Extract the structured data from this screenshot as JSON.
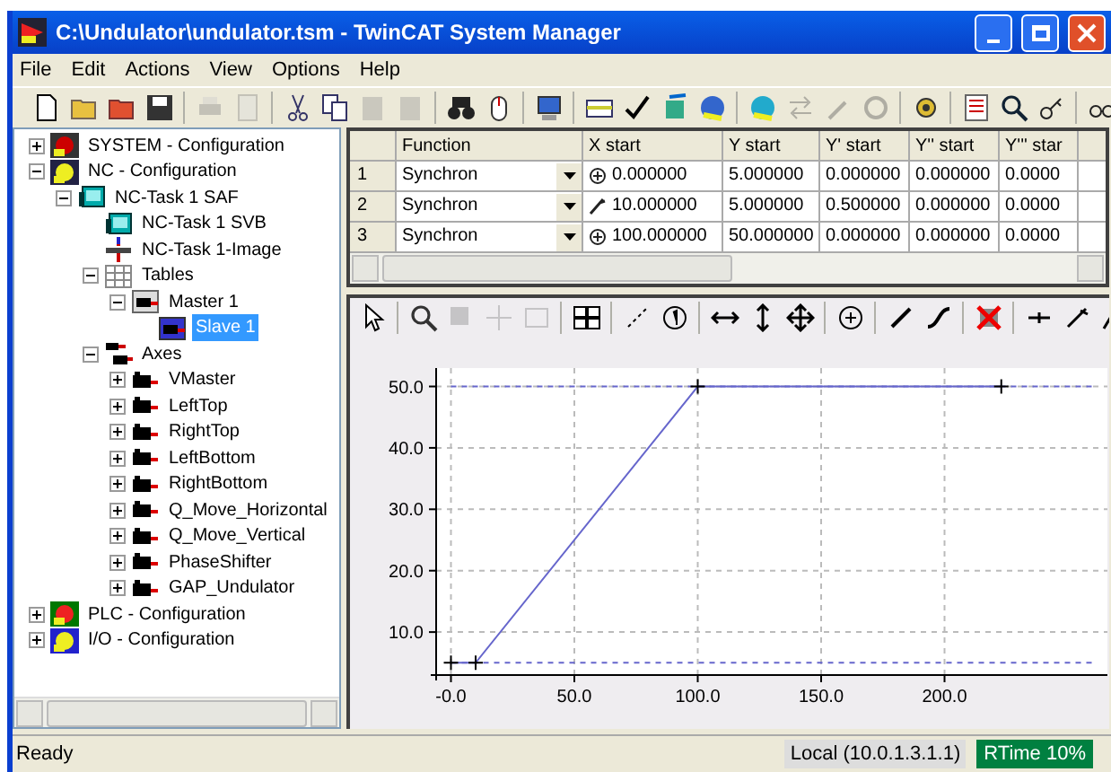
{
  "window": {
    "title": "C:\\Undulator\\undulator.tsm - TwinCAT System Manager"
  },
  "menu": [
    "File",
    "Edit",
    "Actions",
    "View",
    "Options",
    "Help"
  ],
  "tree": [
    {
      "label": "SYSTEM - Configuration",
      "kind": "system",
      "expanded": false
    },
    {
      "label": "NC - Configuration",
      "kind": "nc",
      "expanded": true,
      "children": [
        {
          "label": "NC-Task 1 SAF",
          "kind": "task",
          "expanded": true,
          "children": [
            {
              "label": "NC-Task 1 SVB",
              "kind": "task"
            },
            {
              "label": "NC-Task 1-Image",
              "kind": "image"
            },
            {
              "label": "Tables",
              "kind": "tables",
              "expanded": true,
              "children": [
                {
                  "label": "Master 1",
                  "kind": "table",
                  "expanded": true,
                  "children": [
                    {
                      "label": "Slave 1",
                      "kind": "slave",
                      "selected": true
                    }
                  ]
                }
              ]
            },
            {
              "label": "Axes",
              "kind": "axes",
              "expanded": true,
              "children": [
                {
                  "label": "VMaster",
                  "kind": "axis",
                  "expanded": false
                },
                {
                  "label": "LeftTop",
                  "kind": "axis",
                  "expanded": false
                },
                {
                  "label": "RightTop",
                  "kind": "axis",
                  "expanded": false
                },
                {
                  "label": "LeftBottom",
                  "kind": "axis",
                  "expanded": false
                },
                {
                  "label": "RightBottom",
                  "kind": "axis",
                  "expanded": false
                },
                {
                  "label": "Q_Move_Horizontal",
                  "kind": "axis",
                  "expanded": false
                },
                {
                  "label": "Q_Move_Vertical",
                  "kind": "axis",
                  "expanded": false
                },
                {
                  "label": "PhaseShifter",
                  "kind": "axis",
                  "expanded": false
                },
                {
                  "label": "GAP_Undulator",
                  "kind": "axis",
                  "expanded": false
                }
              ]
            }
          ]
        }
      ]
    },
    {
      "label": "PLC - Configuration",
      "kind": "plc",
      "expanded": false
    },
    {
      "label": "I/O - Configuration",
      "kind": "io",
      "expanded": false
    }
  ],
  "table": {
    "columns": [
      "",
      "Function",
      "X start",
      "Y start",
      "Y' start",
      "Y'' start",
      "Y''' star"
    ],
    "rows": [
      {
        "kind": "circle",
        "cells": [
          "1",
          "Synchron",
          "0.000000",
          "5.000000",
          "0.000000",
          "0.000000",
          "0.0000"
        ]
      },
      {
        "kind": "slope",
        "cells": [
          "2",
          "Synchron",
          "10.000000",
          "5.000000",
          "0.500000",
          "0.000000",
          "0.0000"
        ]
      },
      {
        "kind": "circle",
        "cells": [
          "3",
          "Synchron",
          "100.000000",
          "50.000000",
          "0.000000",
          "0.000000",
          "0.0000"
        ]
      }
    ]
  },
  "chart": {
    "chart_data": {
      "type": "line",
      "x": [
        0,
        10,
        100,
        223
      ],
      "grid": true,
      "ref_lines": [
        {
          "axis": "y",
          "value": 50
        },
        {
          "axis": "y",
          "value": 5
        }
      ],
      "series": [
        {
          "color": "#6666cc",
          "marker": "plus",
          "values": [
            5,
            5,
            50,
            50
          ]
        }
      ],
      "xlim": [
        -6,
        266
      ],
      "ylim": [
        3,
        53
      ],
      "xticks": [
        {
          "value": 0,
          "label": "-0.0"
        },
        {
          "value": 50,
          "label": "50.0"
        },
        {
          "value": 100,
          "label": "100.0"
        },
        {
          "value": 150,
          "label": "150.0"
        },
        {
          "value": 200,
          "label": "200.0"
        }
      ],
      "yticks": [
        {
          "value": 10,
          "label": "10.0"
        },
        {
          "value": 20,
          "label": "20.0"
        },
        {
          "value": 30,
          "label": "30.0"
        },
        {
          "value": 40,
          "label": "40.0"
        },
        {
          "value": 50,
          "label": "50.0"
        }
      ]
    }
  },
  "status_bar": {
    "text": "Ready",
    "target": "Local (10.0.1.3.1.1)",
    "rtime": "RTime 10%"
  }
}
